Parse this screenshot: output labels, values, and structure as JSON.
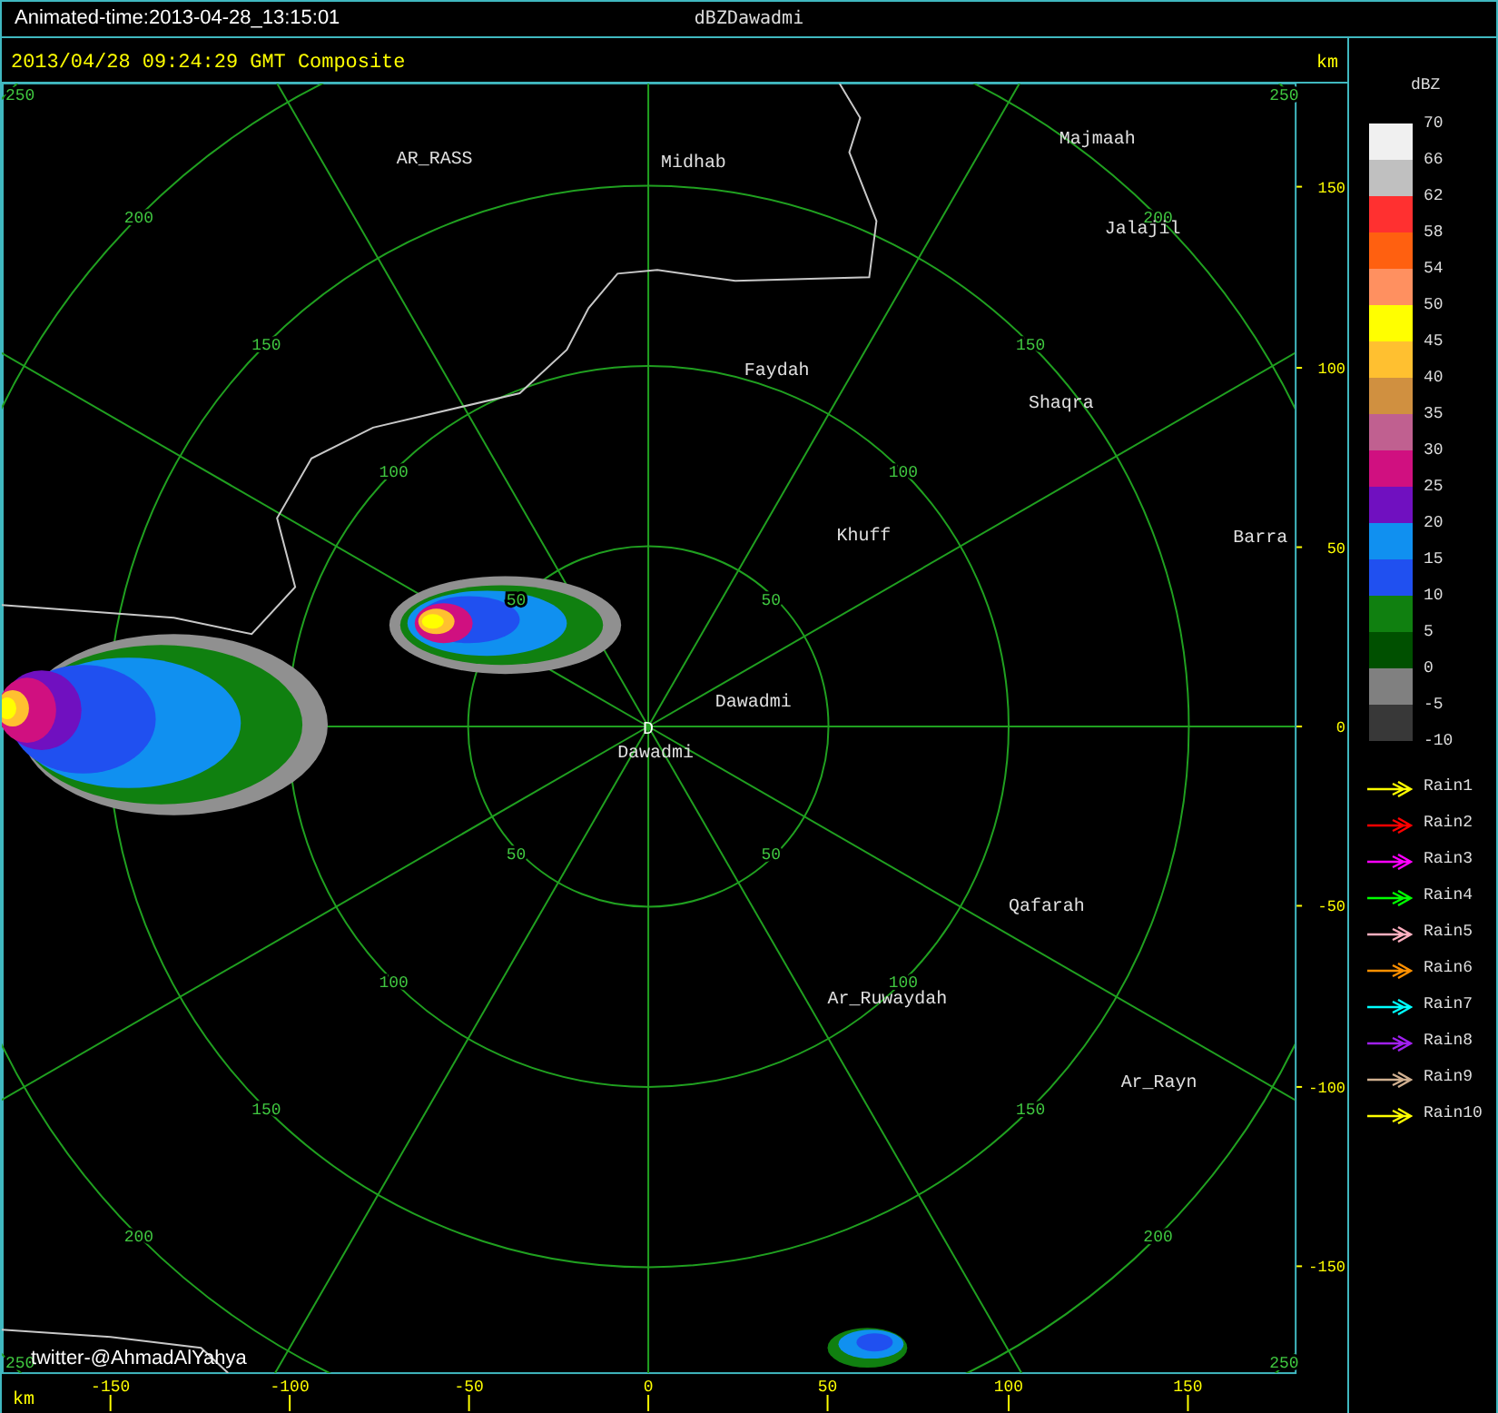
{
  "top_bar": {
    "animated_time": "Animated-time:2013-04-28_13:15:01",
    "title": "dBZDawadmi"
  },
  "header": {
    "timestamp": "2013/04/28 09:24:29 GMT Composite",
    "unit": "km"
  },
  "map": {
    "places": [
      "AR_RASS",
      "Midhab",
      "Majmaah",
      "Jalajil",
      "Faydah",
      "Shaqra",
      "Khuff",
      "Barra",
      "Dawadmi",
      "Dawadmi",
      "Qafarah",
      "Ar_Ruwaydah",
      "Ar_Rayn"
    ],
    "radar_site": "D",
    "range_labels": [
      "250",
      "250",
      "250",
      "250",
      "200",
      "150",
      "100",
      "50",
      "50",
      "100",
      "150",
      "200",
      "50",
      "100",
      "150",
      "200",
      "50",
      "100",
      "150",
      "200"
    ],
    "credit": "twitter-@AhmadAlYahya"
  },
  "right_axis": {
    "ticks": [
      "150",
      "100",
      "50",
      "0",
      "-50",
      "-100",
      "-150"
    ]
  },
  "bottom_axis": {
    "unit": "km",
    "ticks": [
      "-150",
      "-100",
      "-50",
      "0",
      "50",
      "100",
      "150"
    ]
  },
  "legend": {
    "title": "dBZ",
    "bins": [
      {
        "color": "#f0f0f0"
      },
      {
        "color": "#c0c0c0"
      },
      {
        "color": "#ff3030"
      },
      {
        "color": "#ff6010"
      },
      {
        "color": "#ff9060"
      },
      {
        "color": "#ffff00"
      },
      {
        "color": "#ffc030"
      },
      {
        "color": "#d09040"
      },
      {
        "color": "#c06090"
      },
      {
        "color": "#d01080"
      },
      {
        "color": "#7010c0"
      },
      {
        "color": "#1090f0"
      },
      {
        "color": "#2050f0"
      },
      {
        "color": "#108010"
      },
      {
        "color": "#005000"
      },
      {
        "color": "#808080"
      },
      {
        "color": "#383838"
      }
    ],
    "scale": [
      "70",
      "66",
      "62",
      "58",
      "54",
      "50",
      "45",
      "40",
      "35",
      "30",
      "25",
      "20",
      "15",
      "10",
      "5",
      "0",
      "-5",
      "-10"
    ]
  },
  "rain_tracks": [
    {
      "label": "Rain1",
      "color": "#ffff00"
    },
    {
      "label": "Rain2",
      "color": "#ff0000"
    },
    {
      "label": "Rain3",
      "color": "#ff00ff"
    },
    {
      "label": "Rain4",
      "color": "#00ff00"
    },
    {
      "label": "Rain5",
      "color": "#ffb0c0"
    },
    {
      "label": "Rain6",
      "color": "#ff9000"
    },
    {
      "label": "Rain7",
      "color": "#00ffff"
    },
    {
      "label": "Rain8",
      "color": "#a020f0"
    },
    {
      "label": "Rain9",
      "color": "#d0b090"
    },
    {
      "label": "Rain10",
      "color": "#ffff00"
    }
  ]
}
